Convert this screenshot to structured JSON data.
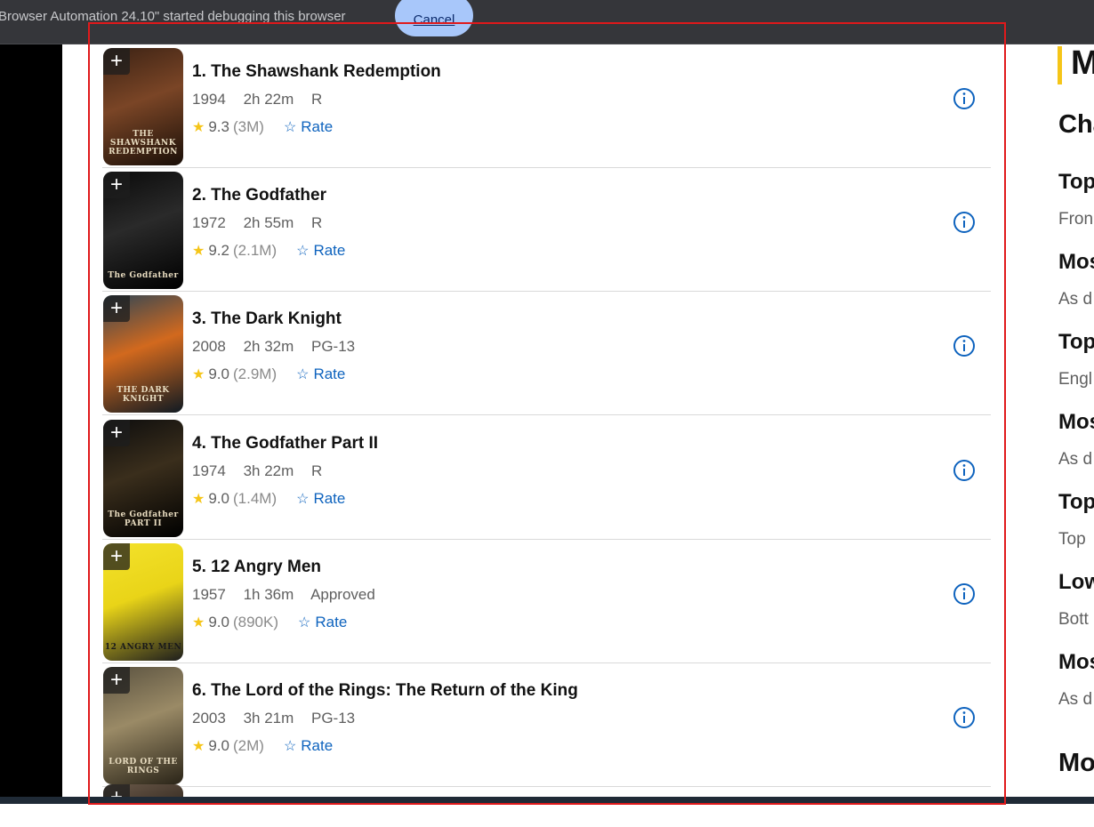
{
  "infobar": {
    "message": "Browser Automation 24.10\" started debugging this browser",
    "cancel_label": "Cancel"
  },
  "movies": [
    {
      "title": "1. The Shawshank Redemption",
      "year": "1994",
      "runtime": "2h 22m",
      "rating": "R",
      "score": "9.3",
      "votes": "(3M)",
      "rate_label": "Rate",
      "poster_caption": "THE SHAWSHANK REDEMPTION",
      "poster_colors": [
        "#3b2214",
        "#7a4526",
        "#1a0f08"
      ]
    },
    {
      "title": "2. The Godfather",
      "year": "1972",
      "runtime": "2h 55m",
      "rating": "R",
      "score": "9.2",
      "votes": "(2.1M)",
      "rate_label": "Rate",
      "poster_caption": "The Godfather",
      "poster_colors": [
        "#0a0a0a",
        "#2a2a2a",
        "#000000"
      ]
    },
    {
      "title": "3. The Dark Knight",
      "year": "2008",
      "runtime": "2h 32m",
      "rating": "PG-13",
      "score": "9.0",
      "votes": "(2.9M)",
      "rate_label": "Rate",
      "poster_caption": "THE DARK KNIGHT",
      "poster_colors": [
        "#2f4656",
        "#d2691e",
        "#101a22"
      ]
    },
    {
      "title": "4. The Godfather Part II",
      "year": "1974",
      "runtime": "3h 22m",
      "rating": "R",
      "score": "9.0",
      "votes": "(1.4M)",
      "rate_label": "Rate",
      "poster_caption": "The Godfather PART II",
      "poster_colors": [
        "#0d0d0d",
        "#3a2e1c",
        "#000000"
      ]
    },
    {
      "title": "5. 12 Angry Men",
      "year": "1957",
      "runtime": "1h 36m",
      "rating": "Approved",
      "score": "9.0",
      "votes": "(890K)",
      "rate_label": "Rate",
      "poster_caption": "12 ANGRY MEN",
      "poster_colors": [
        "#f4e22b",
        "#e9d418",
        "#1d1d1d"
      ]
    },
    {
      "title": "6. The Lord of the Rings: The Return of the King",
      "year": "2003",
      "runtime": "3h 21m",
      "rating": "PG-13",
      "score": "9.0",
      "votes": "(2M)",
      "rate_label": "Rate",
      "poster_caption": "LORD OF THE RINGS",
      "poster_colors": [
        "#5a5240",
        "#9a8a66",
        "#2a2418"
      ]
    }
  ],
  "sidebar": {
    "heading": "M",
    "sub": "Cha",
    "items": [
      {
        "title": "Top",
        "desc": "Fron"
      },
      {
        "title": "Mos",
        "desc": "As d"
      },
      {
        "title": "Top",
        "desc": "Engl"
      },
      {
        "title": "Mos",
        "desc": "As d"
      },
      {
        "title": "Top",
        "desc": "Top"
      },
      {
        "title": "Low",
        "desc": "Bott"
      },
      {
        "title": "Mos",
        "desc": "As d"
      }
    ],
    "bottom": "Mo"
  },
  "colors": {
    "accent_yellow": "#f5c518",
    "link_blue": "#0e63be",
    "selection_red": "#e0191b"
  },
  "icons": {
    "add": "plus-icon",
    "info": "info-circle-icon",
    "star": "star-icon",
    "rate": "star-outline-icon"
  }
}
